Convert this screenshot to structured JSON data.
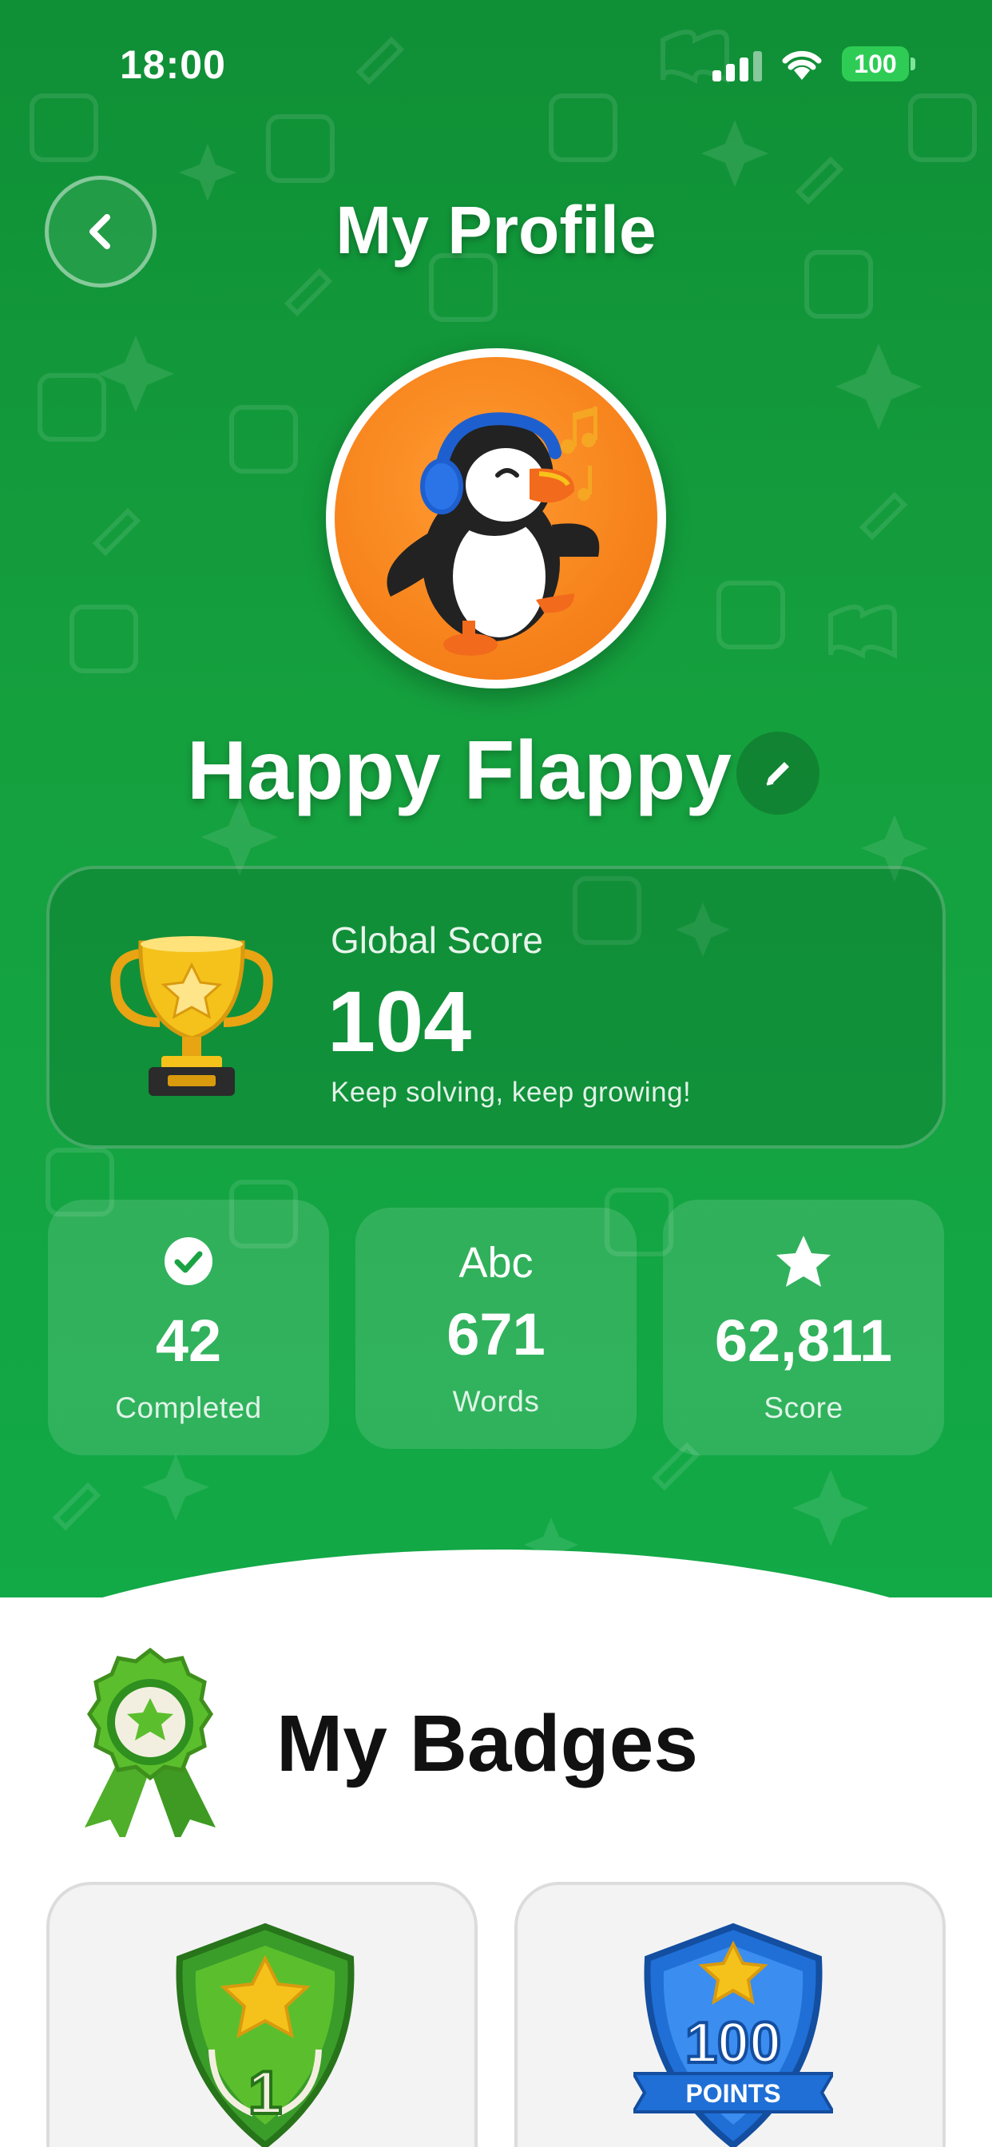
{
  "status_bar": {
    "time": "18:00",
    "battery": "100"
  },
  "header": {
    "title": "My Profile",
    "back_icon": "chevron-left-icon"
  },
  "profile": {
    "name": "Happy Flappy",
    "avatar": "puffin-with-headphones",
    "edit_icon": "pencil-icon"
  },
  "global_score": {
    "label": "Global Score",
    "value": "104",
    "tagline": "Keep solving, keep growing!",
    "icon": "trophy-icon"
  },
  "stats": [
    {
      "icon": "check-circle-icon",
      "icon_text": "",
      "value": "42",
      "label": "Completed"
    },
    {
      "icon": "abc-icon",
      "icon_text": "Abc",
      "value": "671",
      "label": "Words"
    },
    {
      "icon": "star-icon",
      "icon_text": "",
      "value": "62,811",
      "label": "Score"
    }
  ],
  "badges": {
    "title": "My Badges",
    "header_icon": "ribbon-medal-icon",
    "items": [
      {
        "name": "first-win-badge",
        "number": "1"
      },
      {
        "name": "100-points-badge",
        "number": "100",
        "caption": "POINTS"
      }
    ]
  },
  "colors": {
    "hero_green": "#15a03e",
    "avatar_orange": "#f7831c",
    "battery_green": "#2ecc55",
    "badge_blue": "#1f6fd6",
    "badge_green": "#3a9d2a",
    "gold": "#f5c21b"
  }
}
